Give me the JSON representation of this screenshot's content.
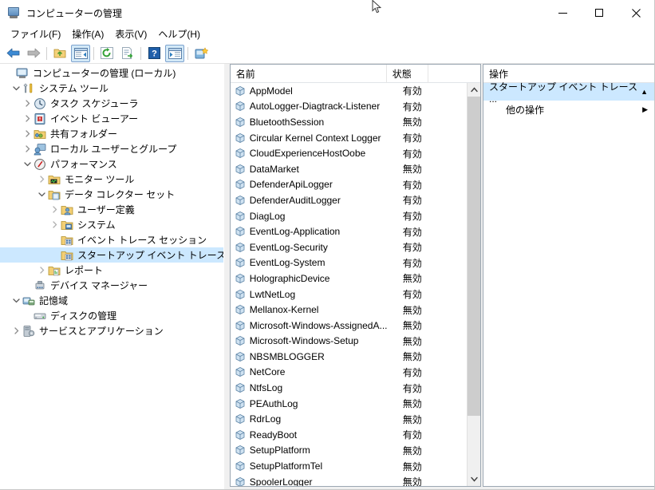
{
  "window": {
    "title": "コンピューターの管理",
    "icon": "computer-management-icon",
    "minimize_label": "最小化",
    "maximize_label": "最大化",
    "close_label": "閉じる"
  },
  "menubar": {
    "items": [
      {
        "label": "ファイル(F)",
        "name": "menu-file"
      },
      {
        "label": "操作(A)",
        "name": "menu-action"
      },
      {
        "label": "表示(V)",
        "name": "menu-view"
      },
      {
        "label": "ヘルプ(H)",
        "name": "menu-help"
      }
    ]
  },
  "toolbar": {
    "buttons": [
      {
        "icon": "back-arrow-icon",
        "checked": false
      },
      {
        "icon": "forward-arrow-icon",
        "checked": false
      },
      {
        "icon": "up-folder-icon",
        "checked": false
      },
      {
        "icon": "show-hide-console-tree-icon",
        "checked": true
      },
      {
        "icon": "refresh-icon",
        "checked": false
      },
      {
        "icon": "export-list-icon",
        "checked": false
      },
      {
        "icon": "help-icon",
        "checked": false
      },
      {
        "icon": "show-hide-action-pane-icon",
        "checked": true
      },
      {
        "icon": "new-window-icon",
        "checked": false
      }
    ]
  },
  "tree": {
    "nodes": [
      {
        "label": "コンピューターの管理 (ローカル)",
        "indent": 0,
        "twisty": "",
        "icon": "computer-icon",
        "selected": false
      },
      {
        "label": "システム ツール",
        "indent": 1,
        "twisty": "expanded",
        "icon": "system-tools-icon",
        "selected": false
      },
      {
        "label": "タスク スケジューラ",
        "indent": 2,
        "twisty": "collapsed",
        "icon": "task-scheduler-icon",
        "selected": false
      },
      {
        "label": "イベント ビューアー",
        "indent": 2,
        "twisty": "collapsed",
        "icon": "event-viewer-icon",
        "selected": false
      },
      {
        "label": "共有フォルダー",
        "indent": 2,
        "twisty": "collapsed",
        "icon": "shared-folders-icon",
        "selected": false
      },
      {
        "label": "ローカル ユーザーとグループ",
        "indent": 2,
        "twisty": "collapsed",
        "icon": "local-users-groups-icon",
        "selected": false
      },
      {
        "label": "パフォーマンス",
        "indent": 2,
        "twisty": "expanded",
        "icon": "performance-icon",
        "selected": false
      },
      {
        "label": "モニター ツール",
        "indent": 3,
        "twisty": "collapsed",
        "icon": "monitoring-tools-icon",
        "selected": false
      },
      {
        "label": "データ コレクター セット",
        "indent": 3,
        "twisty": "expanded",
        "icon": "data-collector-sets-icon",
        "selected": false
      },
      {
        "label": "ユーザー定義",
        "indent": 4,
        "twisty": "collapsed",
        "icon": "user-defined-icon",
        "selected": false
      },
      {
        "label": "システム",
        "indent": 4,
        "twisty": "collapsed",
        "icon": "system-folder-icon",
        "selected": false
      },
      {
        "label": "イベント トレース セッション",
        "indent": 4,
        "twisty": "",
        "icon": "event-trace-sessions-icon",
        "selected": false
      },
      {
        "label": "スタートアップ イベント トレース セッション",
        "indent": 4,
        "twisty": "",
        "icon": "startup-event-trace-sessions-icon",
        "selected": true
      },
      {
        "label": "レポート",
        "indent": 3,
        "twisty": "collapsed",
        "icon": "reports-icon",
        "selected": false
      },
      {
        "label": "デバイス マネージャー",
        "indent": 2,
        "twisty": "",
        "icon": "device-manager-icon",
        "selected": false
      },
      {
        "label": "記憶域",
        "indent": 1,
        "twisty": "expanded",
        "icon": "storage-icon",
        "selected": false
      },
      {
        "label": "ディスクの管理",
        "indent": 2,
        "twisty": "",
        "icon": "disk-management-icon",
        "selected": false
      },
      {
        "label": "サービスとアプリケーション",
        "indent": 1,
        "twisty": "collapsed",
        "icon": "services-applications-icon",
        "selected": false
      }
    ]
  },
  "list": {
    "columns": [
      "名前",
      "状態"
    ],
    "rows": [
      {
        "name": "AppModel",
        "state": "有効"
      },
      {
        "name": "AutoLogger-Diagtrack-Listener",
        "state": "有効"
      },
      {
        "name": "BluetoothSession",
        "state": "無効"
      },
      {
        "name": "Circular Kernel Context Logger",
        "state": "有効"
      },
      {
        "name": "CloudExperienceHostOobe",
        "state": "有効"
      },
      {
        "name": "DataMarket",
        "state": "無効"
      },
      {
        "name": "DefenderApiLogger",
        "state": "有効"
      },
      {
        "name": "DefenderAuditLogger",
        "state": "有効"
      },
      {
        "name": "DiagLog",
        "state": "有効"
      },
      {
        "name": "EventLog-Application",
        "state": "有効"
      },
      {
        "name": "EventLog-Security",
        "state": "有効"
      },
      {
        "name": "EventLog-System",
        "state": "有効"
      },
      {
        "name": "HolographicDevice",
        "state": "無効"
      },
      {
        "name": "LwtNetLog",
        "state": "有効"
      },
      {
        "name": "Mellanox-Kernel",
        "state": "無効"
      },
      {
        "name": "Microsoft-Windows-AssignedA...",
        "state": "無効"
      },
      {
        "name": "Microsoft-Windows-Setup",
        "state": "無効"
      },
      {
        "name": "NBSMBLOGGER",
        "state": "無効"
      },
      {
        "name": "NetCore",
        "state": "有効"
      },
      {
        "name": "NtfsLog",
        "state": "有効"
      },
      {
        "name": "PEAuthLog",
        "state": "無効"
      },
      {
        "name": "RdrLog",
        "state": "無効"
      },
      {
        "name": "ReadyBoot",
        "state": "有効"
      },
      {
        "name": "SetupPlatform",
        "state": "無効"
      },
      {
        "name": "SetupPlatformTel",
        "state": "無効"
      },
      {
        "name": "SpoolerLogger",
        "state": "無効"
      }
    ],
    "scroll": {
      "up_arrow": "▲",
      "down_arrow": "▼"
    }
  },
  "actions": {
    "header": "操作",
    "group_label": "スタートアップ イベント トレース ...",
    "group_collapse_glyph": "▲",
    "items": [
      {
        "label": "他の操作",
        "submenu_glyph": "▶"
      }
    ]
  },
  "colors": {
    "selection": "#cce8ff",
    "toolbar_checked": "#d3e9f7",
    "pane_background": "#f0f0f0",
    "border": "#9ba7b2"
  }
}
